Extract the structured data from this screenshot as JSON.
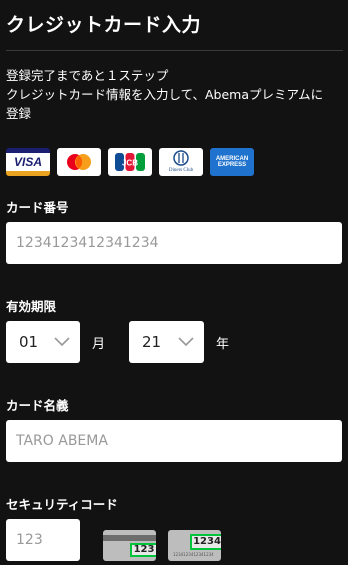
{
  "page": {
    "title": "クレジットカード入力",
    "description_lines": [
      "登録完了まであと１ステップ",
      "クレジットカード情報を入力して、Abemaプレミアムに",
      "登録"
    ]
  },
  "card_brands": [
    {
      "name": "visa-logo",
      "text": "VISA"
    },
    {
      "name": "mastercard-logo",
      "text": ""
    },
    {
      "name": "jcb-logo",
      "text": "JCB"
    },
    {
      "name": "diners-club-logo",
      "text": "Diners Club"
    },
    {
      "name": "amex-logo",
      "text": "AMERICAN EXPRESS"
    }
  ],
  "form": {
    "card_number": {
      "label": "カード番号",
      "placeholder": "1234123412341234"
    },
    "expiry": {
      "label": "有効期限",
      "month_value": "01",
      "month_unit": "月",
      "year_value": "21",
      "year_unit": "年"
    },
    "card_name": {
      "label": "カード名義",
      "placeholder": "TARO ABEMA"
    },
    "security_code": {
      "label": "セキュリティコード",
      "placeholder": "123",
      "back_example": "123",
      "front_example": "1234",
      "front_small_digits": "1234123412341234"
    }
  },
  "colors": {
    "background": "#121212",
    "highlight": "#00c53b"
  }
}
